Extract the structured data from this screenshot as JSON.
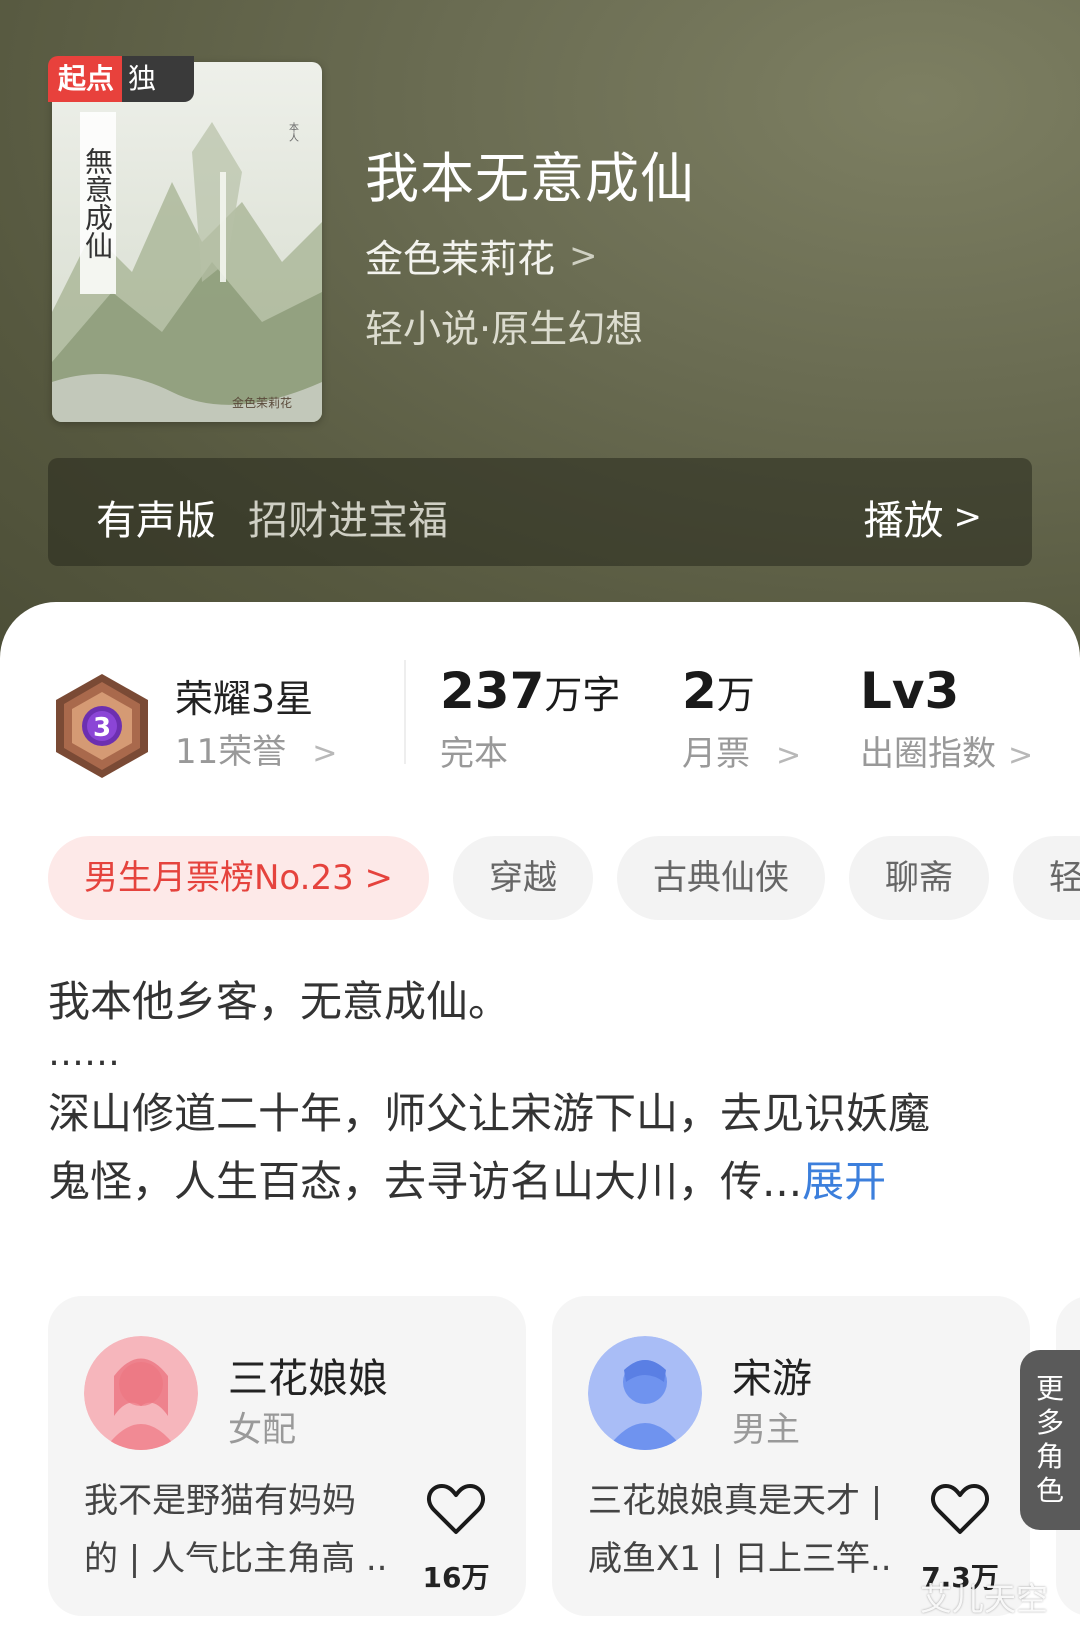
{
  "book": {
    "title": "我本无意成仙",
    "author": "金色茉莉花",
    "genre": "轻小说·原生幻想",
    "badge_brand": "起点",
    "badge_exclusive": "独家",
    "cover_title": "無意成仙"
  },
  "audio": {
    "label": "有声版",
    "narrator": "招财进宝福",
    "play_label": "播放"
  },
  "stats": {
    "honor_name": "荣耀3星",
    "honor_count": "11荣誉",
    "medal_level": "3",
    "words_value": "237",
    "words_unit": "万字",
    "words_sub": "完本",
    "monthly_value": "2",
    "monthly_unit": "万",
    "monthly_sub": "月票",
    "level_value": "Lv3",
    "level_sub": "出圈指数"
  },
  "tags": {
    "rank": "男生月票榜No.23 >",
    "items": [
      "穿越",
      "古典仙侠",
      "聊斋",
      "轻"
    ]
  },
  "description": {
    "line1": "我本他乡客，无意成仙。",
    "ellipsis": "……",
    "line2": "深山修道二十年，师父让宋游下山，去见识妖魔",
    "line3": "鬼怪，人生百态，去寻访名山大川，传...",
    "expand": "展开"
  },
  "characters": [
    {
      "name": "三花娘娘",
      "role": "女配",
      "quote_line1": "我不是野猫有妈妈",
      "quote_line2": "的 | 人气比主角高 ...",
      "likes": "16万",
      "avatar_color": "#f18a94"
    },
    {
      "name": "宋游",
      "role": "男主",
      "quote_line1": "三花娘娘真是天才 |",
      "quote_line2": "咸鱼X1 | 日上三竿...",
      "likes": "7.3万",
      "avatar_color": "#6f93ef"
    }
  ],
  "more_roles": "更多角色",
  "watermark": "艾儿天空",
  "colors": {
    "header_bg": "#5d5f46",
    "accent_red": "#e5433d",
    "link_blue": "#3c7fdc"
  }
}
